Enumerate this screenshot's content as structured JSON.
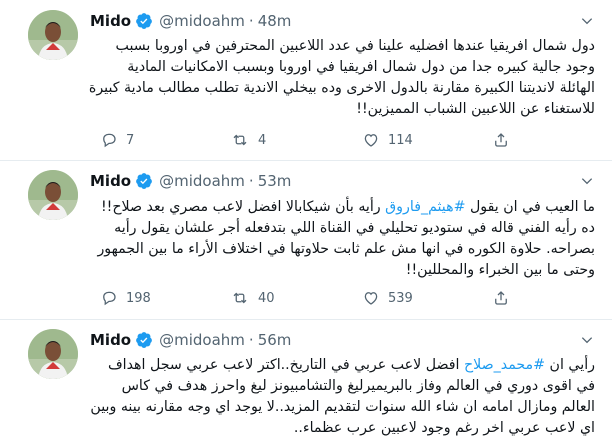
{
  "tweets": [
    {
      "author": {
        "name": "Mido",
        "handle": "@midoahm",
        "time": "48m"
      },
      "text": "دول شمال افريقيا عندها افضليه علينا في عدد اللاعبين المحترفين في اوروبا بسبب وجود جالية كبيره جدا من دول شمال افريقيا في اوروبا وبسبب الامكانيات المادية الهائلة لانديتنا الكبيرة مقارنة بالدول الاخرى وده بيخلي الاندية تطلب مطالب مادية كبيرة للاستغناء عن اللاعبين الشباب المميزين!!",
      "stats": {
        "replies": "7",
        "retweets": "4",
        "likes": "114"
      }
    },
    {
      "author": {
        "name": "Mido",
        "handle": "@midoahm",
        "time": "53m"
      },
      "text_before": "ما العيب في ان يقول ",
      "hashtag": "#هيثم_فاروق",
      "text_after": " رأيه بأن شيكابالا افضل لاعب مصري بعد صلاح!! ده رأيه الفني قاله في ستوديو تحليلي في القناة اللي بتدفعله أجر علشان يقول رأيه بصراحه. حلاوة الكوره في انها مش علم ثابت حلاوتها في اختلاف الأراء ما بين الجمهور وحتى ما بين الخبراء والمحللين!!",
      "stats": {
        "replies": "198",
        "retweets": "40",
        "likes": "539"
      }
    },
    {
      "author": {
        "name": "Mido",
        "handle": "@midoahm",
        "time": "56m"
      },
      "text_before": "رأيي ان ",
      "hashtag": "#محمد_صلاح",
      "text_after": " افضل لاعب عربي في التاريخ..اكتر لاعب عربي سجل اهداف في اقوى دوري في العالم وفاز بالبريميرليغ والتشامبيونز ليغ واحرز هدف في كاس العالم ومازال امامه ان شاء الله سنوات لتقديم المزيد..لا يوجد اي وجه مقارنه بينه وبين اي لاعب عربي اخر رغم وجود لاعبين عرب عظماء.."
    }
  ],
  "icons": {
    "verified": "verified-badge-icon",
    "caret": "chevron-down-icon",
    "reply": "reply-icon",
    "retweet": "retweet-icon",
    "like": "heart-icon",
    "share": "share-icon"
  },
  "colors": {
    "hashtag": "#1d9bf0",
    "verified": "#1d9bf0",
    "muted": "#536471",
    "text": "#0f1419"
  }
}
